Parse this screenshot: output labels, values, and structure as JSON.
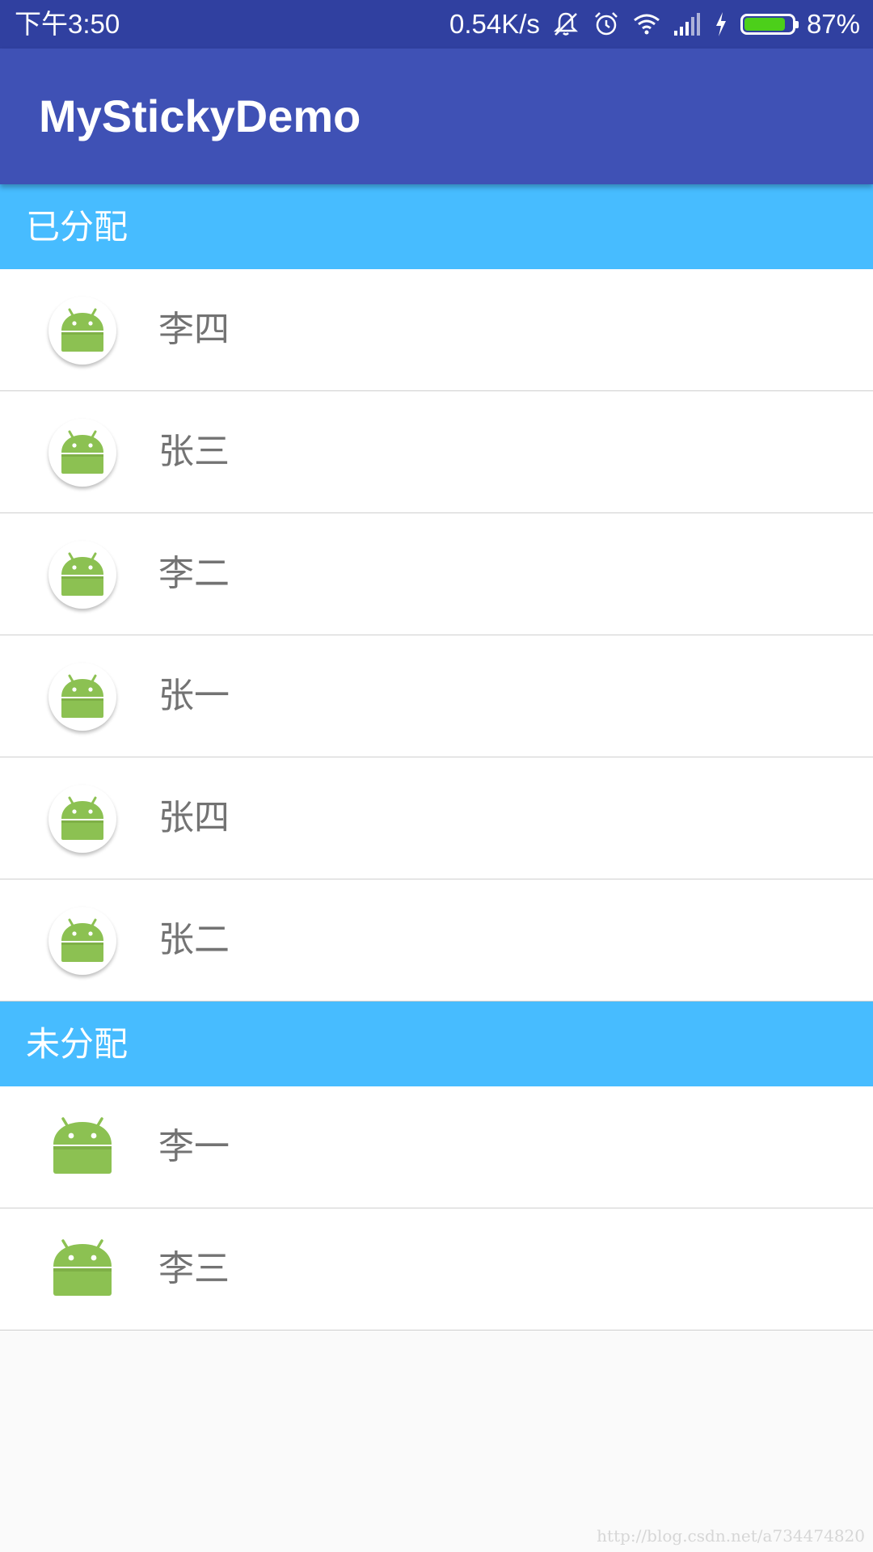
{
  "status_bar": {
    "time": "下午3:50",
    "net_speed": "0.54K/s",
    "battery_text": "87%",
    "battery_level": 0.87,
    "icons": [
      "mute-bell-icon",
      "alarm-icon",
      "wifi-icon",
      "signal-icon",
      "charging-icon",
      "battery-icon"
    ],
    "color": "#3040a0"
  },
  "app_bar": {
    "title": "MyStickyDemo",
    "color": "#3f51b5"
  },
  "sections": [
    {
      "header": "已分配",
      "items": [
        {
          "name": "李四",
          "avatar": "android-round"
        },
        {
          "name": "张三",
          "avatar": "android-round"
        },
        {
          "name": "李二",
          "avatar": "android-round"
        },
        {
          "name": "张一",
          "avatar": "android-round"
        },
        {
          "name": "张四",
          "avatar": "android-round"
        },
        {
          "name": "张二",
          "avatar": "android-round"
        }
      ]
    },
    {
      "header": "未分配",
      "items": [
        {
          "name": "李一",
          "avatar": "android-plain"
        },
        {
          "name": "李三",
          "avatar": "android-plain"
        }
      ]
    }
  ],
  "header_color": "#47bcff",
  "watermark": "http://blog.csdn.net/a734474820"
}
